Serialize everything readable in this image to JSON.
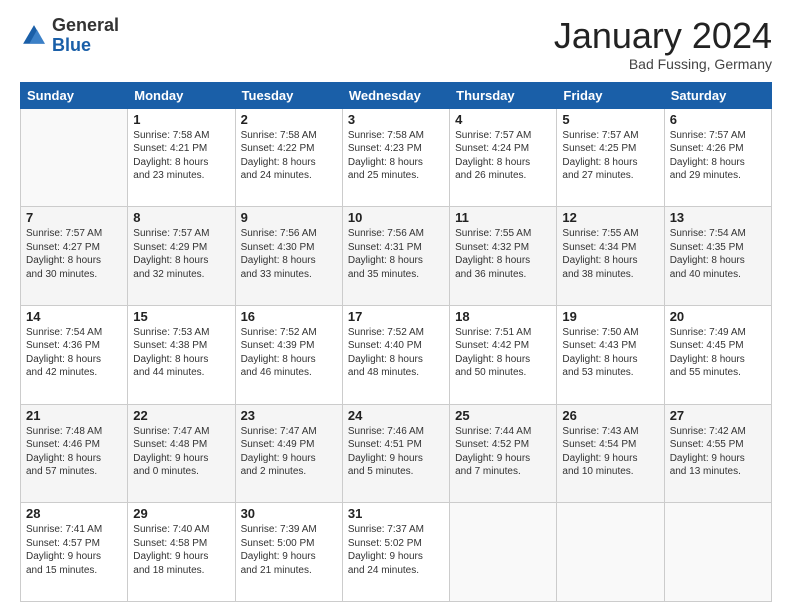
{
  "logo": {
    "general": "General",
    "blue": "Blue"
  },
  "header": {
    "month": "January 2024",
    "location": "Bad Fussing, Germany"
  },
  "days": [
    "Sunday",
    "Monday",
    "Tuesday",
    "Wednesday",
    "Thursday",
    "Friday",
    "Saturday"
  ],
  "weeks": [
    [
      {
        "num": "",
        "info": ""
      },
      {
        "num": "1",
        "info": "Sunrise: 7:58 AM\nSunset: 4:21 PM\nDaylight: 8 hours\nand 23 minutes."
      },
      {
        "num": "2",
        "info": "Sunrise: 7:58 AM\nSunset: 4:22 PM\nDaylight: 8 hours\nand 24 minutes."
      },
      {
        "num": "3",
        "info": "Sunrise: 7:58 AM\nSunset: 4:23 PM\nDaylight: 8 hours\nand 25 minutes."
      },
      {
        "num": "4",
        "info": "Sunrise: 7:57 AM\nSunset: 4:24 PM\nDaylight: 8 hours\nand 26 minutes."
      },
      {
        "num": "5",
        "info": "Sunrise: 7:57 AM\nSunset: 4:25 PM\nDaylight: 8 hours\nand 27 minutes."
      },
      {
        "num": "6",
        "info": "Sunrise: 7:57 AM\nSunset: 4:26 PM\nDaylight: 8 hours\nand 29 minutes."
      }
    ],
    [
      {
        "num": "7",
        "info": "Sunrise: 7:57 AM\nSunset: 4:27 PM\nDaylight: 8 hours\nand 30 minutes."
      },
      {
        "num": "8",
        "info": "Sunrise: 7:57 AM\nSunset: 4:29 PM\nDaylight: 8 hours\nand 32 minutes."
      },
      {
        "num": "9",
        "info": "Sunrise: 7:56 AM\nSunset: 4:30 PM\nDaylight: 8 hours\nand 33 minutes."
      },
      {
        "num": "10",
        "info": "Sunrise: 7:56 AM\nSunset: 4:31 PM\nDaylight: 8 hours\nand 35 minutes."
      },
      {
        "num": "11",
        "info": "Sunrise: 7:55 AM\nSunset: 4:32 PM\nDaylight: 8 hours\nand 36 minutes."
      },
      {
        "num": "12",
        "info": "Sunrise: 7:55 AM\nSunset: 4:34 PM\nDaylight: 8 hours\nand 38 minutes."
      },
      {
        "num": "13",
        "info": "Sunrise: 7:54 AM\nSunset: 4:35 PM\nDaylight: 8 hours\nand 40 minutes."
      }
    ],
    [
      {
        "num": "14",
        "info": "Sunrise: 7:54 AM\nSunset: 4:36 PM\nDaylight: 8 hours\nand 42 minutes."
      },
      {
        "num": "15",
        "info": "Sunrise: 7:53 AM\nSunset: 4:38 PM\nDaylight: 8 hours\nand 44 minutes."
      },
      {
        "num": "16",
        "info": "Sunrise: 7:52 AM\nSunset: 4:39 PM\nDaylight: 8 hours\nand 46 minutes."
      },
      {
        "num": "17",
        "info": "Sunrise: 7:52 AM\nSunset: 4:40 PM\nDaylight: 8 hours\nand 48 minutes."
      },
      {
        "num": "18",
        "info": "Sunrise: 7:51 AM\nSunset: 4:42 PM\nDaylight: 8 hours\nand 50 minutes."
      },
      {
        "num": "19",
        "info": "Sunrise: 7:50 AM\nSunset: 4:43 PM\nDaylight: 8 hours\nand 53 minutes."
      },
      {
        "num": "20",
        "info": "Sunrise: 7:49 AM\nSunset: 4:45 PM\nDaylight: 8 hours\nand 55 minutes."
      }
    ],
    [
      {
        "num": "21",
        "info": "Sunrise: 7:48 AM\nSunset: 4:46 PM\nDaylight: 8 hours\nand 57 minutes."
      },
      {
        "num": "22",
        "info": "Sunrise: 7:47 AM\nSunset: 4:48 PM\nDaylight: 9 hours\nand 0 minutes."
      },
      {
        "num": "23",
        "info": "Sunrise: 7:47 AM\nSunset: 4:49 PM\nDaylight: 9 hours\nand 2 minutes."
      },
      {
        "num": "24",
        "info": "Sunrise: 7:46 AM\nSunset: 4:51 PM\nDaylight: 9 hours\nand 5 minutes."
      },
      {
        "num": "25",
        "info": "Sunrise: 7:44 AM\nSunset: 4:52 PM\nDaylight: 9 hours\nand 7 minutes."
      },
      {
        "num": "26",
        "info": "Sunrise: 7:43 AM\nSunset: 4:54 PM\nDaylight: 9 hours\nand 10 minutes."
      },
      {
        "num": "27",
        "info": "Sunrise: 7:42 AM\nSunset: 4:55 PM\nDaylight: 9 hours\nand 13 minutes."
      }
    ],
    [
      {
        "num": "28",
        "info": "Sunrise: 7:41 AM\nSunset: 4:57 PM\nDaylight: 9 hours\nand 15 minutes."
      },
      {
        "num": "29",
        "info": "Sunrise: 7:40 AM\nSunset: 4:58 PM\nDaylight: 9 hours\nand 18 minutes."
      },
      {
        "num": "30",
        "info": "Sunrise: 7:39 AM\nSunset: 5:00 PM\nDaylight: 9 hours\nand 21 minutes."
      },
      {
        "num": "31",
        "info": "Sunrise: 7:37 AM\nSunset: 5:02 PM\nDaylight: 9 hours\nand 24 minutes."
      },
      {
        "num": "",
        "info": ""
      },
      {
        "num": "",
        "info": ""
      },
      {
        "num": "",
        "info": ""
      }
    ]
  ]
}
